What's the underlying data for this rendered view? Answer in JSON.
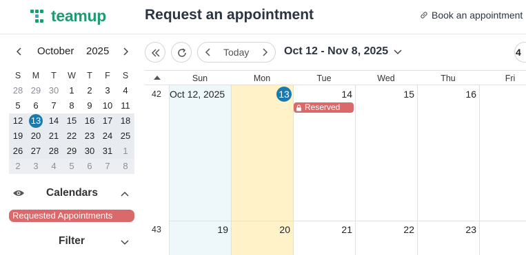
{
  "app": {
    "logo_text": "teamup",
    "page_title": "Request an appointment",
    "book_link": "Book an appointment",
    "brand_color": "#1f9a72",
    "accent_color": "#1a7ab0",
    "calendar_color": "#d9696b"
  },
  "mini_calendar": {
    "month": "October",
    "year": "2025",
    "weekdays": [
      "S",
      "M",
      "T",
      "W",
      "T",
      "F",
      "S"
    ],
    "weeks": [
      [
        "28",
        "29",
        "30",
        "1",
        "2",
        "3",
        "4"
      ],
      [
        "5",
        "6",
        "7",
        "8",
        "9",
        "10",
        "11"
      ],
      [
        "12",
        "13",
        "14",
        "15",
        "16",
        "17",
        "18"
      ],
      [
        "19",
        "20",
        "21",
        "22",
        "23",
        "24",
        "25"
      ],
      [
        "26",
        "27",
        "28",
        "29",
        "30",
        "31",
        "1"
      ],
      [
        "2",
        "3",
        "4",
        "5",
        "6",
        "7",
        "8"
      ]
    ],
    "today": "13"
  },
  "sidebar": {
    "calendars_label": "Calendars",
    "calendar_item": "Requested Appointments",
    "filter_label": "Filter"
  },
  "toolbar": {
    "today_label": "Today",
    "range_label": "Oct 12 - Nov 8, 2025",
    "partial_button": "4"
  },
  "grid": {
    "days": [
      "Sun",
      "Mon",
      "Tue",
      "Wed",
      "Thu",
      "Fri"
    ],
    "weeks": [
      {
        "number": "42",
        "dates": [
          "Oct 12, 2025",
          "13",
          "14",
          "15",
          "16",
          ""
        ]
      },
      {
        "number": "43",
        "dates": [
          "19",
          "20",
          "21",
          "22",
          "23",
          ""
        ]
      }
    ],
    "event": {
      "label": "Reserved",
      "icon": "lock-icon"
    }
  }
}
